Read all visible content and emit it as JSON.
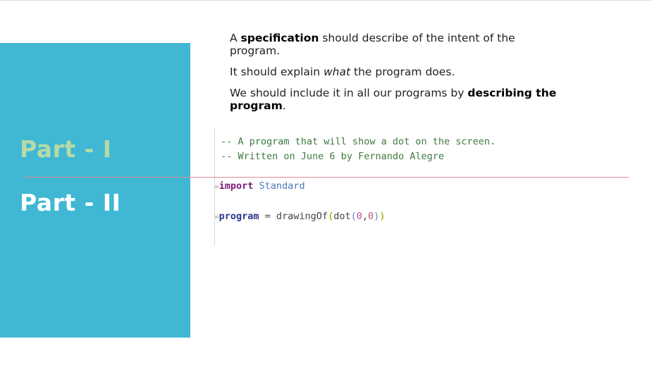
{
  "spec": {
    "p1_a": "A ",
    "p1_b": "specification",
    "p1_c": " should describe of the intent of the program.",
    "p2_a": "It should explain ",
    "p2_b": "what",
    "p2_c": " the program does.",
    "p3_a": "We should include it in all our programs by ",
    "p3_b": "describing the program",
    "p3_c": "."
  },
  "sidebar": {
    "part1": "Part - I",
    "part2": "Part - II"
  },
  "code": {
    "comment1": "-- A program that will show a dot on the screen.",
    "comment2": "-- Written on June 6 by Fernando Alegre",
    "import_kw": "import",
    "import_mod": "Standard",
    "prog_name": "program",
    "prog_eq": " = drawingOf",
    "prog_open": "(",
    "prog_dot": "dot",
    "prog_inner_open": "(",
    "prog_x": "0",
    "prog_comma": ",",
    "prog_y": "0",
    "prog_inner_close": ")",
    "prog_close": ")",
    "line_marker": "»"
  },
  "colors": {
    "panel": "#40b8d4",
    "part1": "#b6dba6",
    "part2": "#ffffff",
    "divider": "#e58a96"
  }
}
